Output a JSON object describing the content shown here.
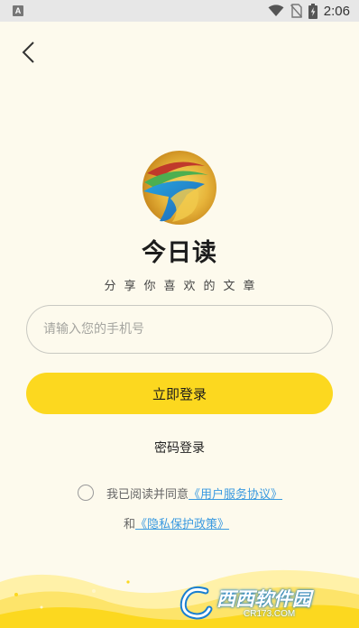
{
  "status_bar": {
    "notification_icon_letter": "A",
    "time": "2:06",
    "icons": [
      "wifi-icon",
      "no-sim-icon",
      "battery-icon"
    ]
  },
  "header": {
    "back_icon": "chevron-left-icon"
  },
  "app": {
    "name": "今日读",
    "slogan": "分享你喜欢的文章"
  },
  "login_form": {
    "phone_placeholder": "请输入您的手机号",
    "phone_value": "",
    "login_button": "立即登录",
    "password_login": "密码登录"
  },
  "agreement": {
    "checked": false,
    "prefix": "我已阅读并同意",
    "user_agreement": "《用户服务协议》",
    "and": "和",
    "privacy_policy": "《隐私保护政策》"
  },
  "watermark": {
    "brand": "西西软件园",
    "url": "CR173.COM"
  },
  "colors": {
    "background": "#fdfaed",
    "primary_button": "#fcd81f",
    "link": "#3a9ae0",
    "wave_light": "#fff1a8",
    "wave_dark": "#fcd81f"
  }
}
